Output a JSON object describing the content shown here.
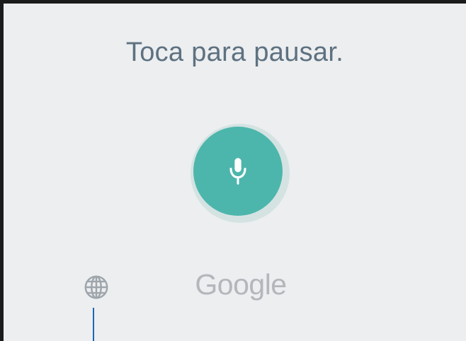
{
  "voice_input": {
    "prompt": "Toca para pausar.",
    "mic_button_icon": "microphone-icon",
    "language_icon": "globe-icon",
    "logo_text": "Google"
  },
  "colors": {
    "background": "#eceef0",
    "prompt_text": "#5e7180",
    "mic_accent": "#4db6ac",
    "mic_halo": "#d4e3e2",
    "logo": "#b3b7bb",
    "cursor_line": "#1a67b5"
  }
}
